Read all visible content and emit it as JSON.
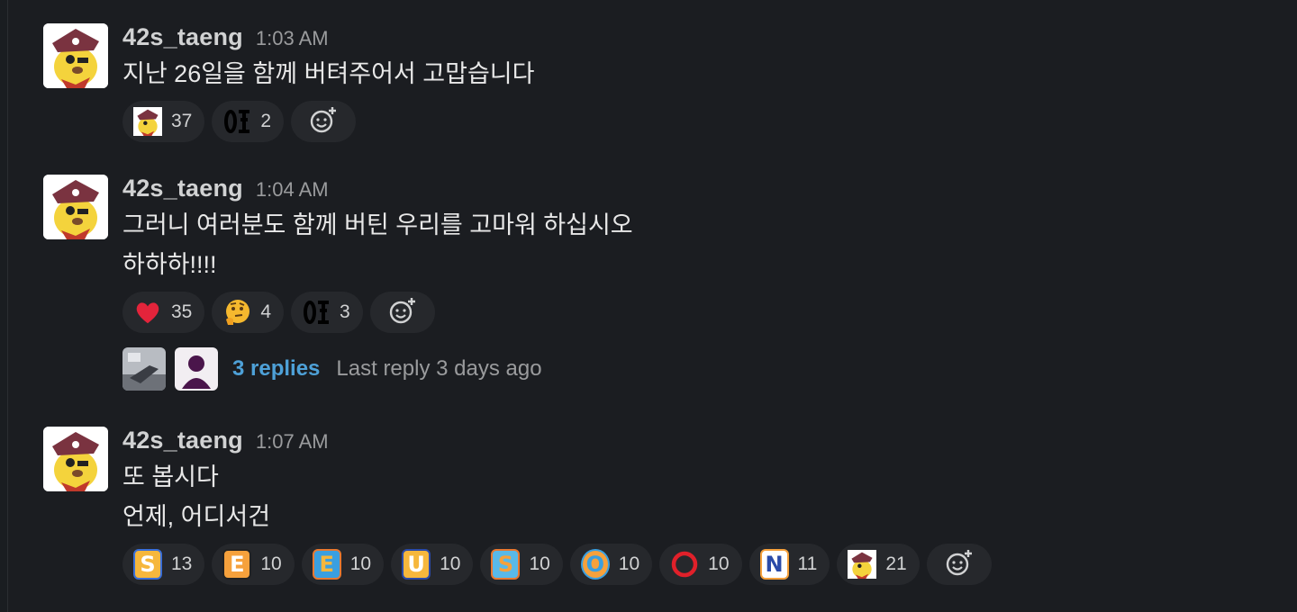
{
  "messages": [
    {
      "author": "42s_taeng",
      "time": "1:03 AM",
      "lines": [
        "지난 26일을 함께 버텨주어서 고맙습니다"
      ],
      "reactions": [
        {
          "emoji": "taeng-custom",
          "count": "37"
        },
        {
          "emoji": "ox-custom",
          "count": "2"
        }
      ]
    },
    {
      "author": "42s_taeng",
      "time": "1:04 AM",
      "lines": [
        "그러니 여러분도 함께 버틴 우리를 고마워 하십시오",
        "하하하!!!!"
      ],
      "reactions": [
        {
          "emoji": "heart",
          "count": "35"
        },
        {
          "emoji": "thinking-face",
          "count": "4"
        },
        {
          "emoji": "ox-custom",
          "count": "3"
        }
      ],
      "thread": {
        "replies": "3 replies",
        "last_reply": "Last reply 3 days ago"
      }
    },
    {
      "author": "42s_taeng",
      "time": "1:07 AM",
      "lines": [
        "또 봅시다",
        "언제, 어디서건"
      ],
      "reactions": [
        {
          "emoji": "letter-s",
          "letter": "S",
          "count": "13"
        },
        {
          "emoji": "letter-e",
          "letter": "E",
          "count": "10"
        },
        {
          "emoji": "letter-e-alt",
          "letter": "E",
          "count": "10"
        },
        {
          "emoji": "letter-u",
          "letter": "U",
          "count": "10"
        },
        {
          "emoji": "letter-s-alt",
          "letter": "S",
          "count": "10"
        },
        {
          "emoji": "letter-o",
          "letter": "O",
          "count": "10"
        },
        {
          "emoji": "red-circle",
          "count": "10"
        },
        {
          "emoji": "letter-n",
          "letter": "N",
          "count": "11"
        },
        {
          "emoji": "taeng-custom",
          "count": "21"
        }
      ]
    }
  ],
  "colors": {
    "background": "#1b1d21",
    "pill": "#26282c",
    "link": "#4ea1d8",
    "muted": "#9a9b9d"
  }
}
